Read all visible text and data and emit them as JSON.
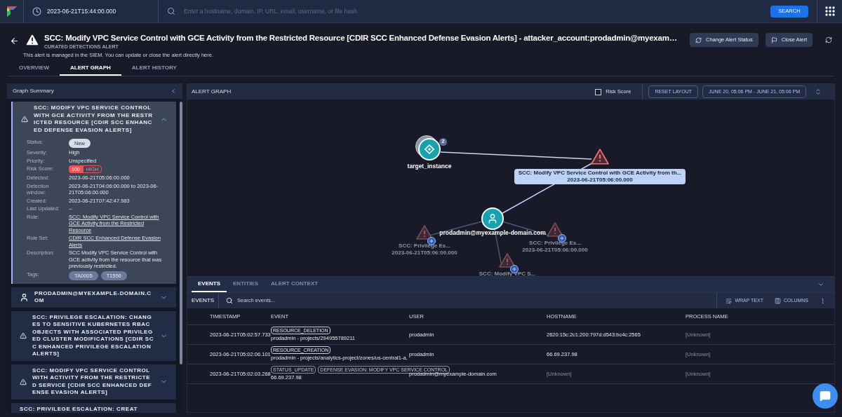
{
  "top_bar": {
    "time": "2023-06-21T15:44:00.000",
    "search_placeholder": "Enter a hostname, domain, IP, URL, email, username, or file hash",
    "search_button": "SEARCH"
  },
  "header": {
    "title": "SCC: Modify VPC Service Control with GCE Activity from the Restricted Resource [CDIR SCC Enhanced Defense Evasion Alerts] - attacker_account:prodadmin@myexam…",
    "subtitle": "CURATED DETECTIONS ALERT",
    "note": "This alert is managed in the SIEM. You can update or close the alert directly here.",
    "buttons": [
      {
        "kind": "status",
        "label": "Change Alert Status"
      },
      {
        "kind": "close",
        "label": "Close Alert"
      }
    ]
  },
  "tabs": [
    {
      "label": "OVERVIEW",
      "selected": false
    },
    {
      "label": "ALERT GRAPH",
      "selected": true
    },
    {
      "label": "ALERT HISTORY",
      "selected": false
    }
  ],
  "summary": {
    "title": "Graph Summary",
    "items": [
      {
        "kind": "alert",
        "title": "SCC: MODIFY VPC SERVICE CONTROL WITH GCE ACTIVITY FROM THE RESTRICTED RESOURCE [CDIR SCC ENHANCED DEFENSE EVASION ALERTS]",
        "expanded": true,
        "fields": [
          {
            "kind": "pill",
            "label": "Status:",
            "value": "New"
          },
          {
            "kind": "text",
            "label": "Severity:",
            "value": "High"
          },
          {
            "kind": "text",
            "label": "Priority:",
            "value": "Unspecified"
          },
          {
            "kind": "risk",
            "label": "Risk Score:",
            "score": "100",
            "level_text": "HIGH"
          },
          {
            "kind": "text",
            "label": "Detected:",
            "value": "2023-06-21T05:06:00.000"
          },
          {
            "kind": "text",
            "label": "Detection window:",
            "value": "2023-06-21T04:06:00.000 to 2023-06-21T05:06:00.000"
          },
          {
            "kind": "text",
            "label": "Created:",
            "value": "2023-06-21T07:42:47.983"
          },
          {
            "kind": "text",
            "label": "Last Updated:",
            "value": "--"
          },
          {
            "kind": "link",
            "label": "Rule:",
            "value": "SCC: Modify VPC Service Control with GCE Activity from the Restricted Resource"
          },
          {
            "kind": "link",
            "label": "Rule Set:",
            "value": "CDIR SCC Enhanced Defense Evasion Alerts"
          },
          {
            "kind": "text",
            "label": "Description:",
            "value": "SCC Modify VPC Service Control with GCE activity from the resource that was previously restricted."
          },
          {
            "kind": "tags",
            "label": "Tags:",
            "tags": [
              "TA0005",
              "T1556"
            ]
          }
        ]
      },
      {
        "kind": "user",
        "title": "PRODADMIN@MYEXAMPLE-DOMAIN.COM",
        "expanded": false
      },
      {
        "kind": "alert",
        "title": "SCC: PRIVILEGE ESCALATION: CHANGES TO SENSITIVE KUBERNETES RBAC OBJECTS WITH ASSOCIATED PRIVILEGED CLUSTER MODIFICATIONS [CDIR SCC ENHANCED PRIVILEGE ESCALATION ALERTS]",
        "expanded": false
      },
      {
        "kind": "alert",
        "title": "SCC: MODIFY VPC SERVICE CONTROL WITH ACTIVITY FROM THE RESTRICTED SERVICE [CDIR SCC ENHANCED DEFENSE EVASION ALERTS]",
        "expanded": false
      },
      {
        "kind": "partial",
        "title": "SCC: PRIVILEGE ESCALATION: CREAT",
        "expanded": false
      }
    ]
  },
  "graph": {
    "title": "ALERT GRAPH",
    "risk_score": {
      "label": "Risk Score",
      "checked": false
    },
    "reset": "RESET LAYOUT",
    "range": "JUNE 20, 05:06 PM - JUNE 21, 05:06 PM",
    "nodes": [
      {
        "kind": "asset",
        "label": "target_instance",
        "badge": "2"
      },
      {
        "kind": "alert",
        "label": "SCC: Modify VPC Service Control with GCE Activity from th...",
        "sublabel": "2023-06-21T05:06:00.000",
        "selected": true
      },
      {
        "kind": "user",
        "label": "prodadmin@myexample-domain.com"
      },
      {
        "kind": "alert",
        "label": "SCC: Privilege Es...",
        "sublabel": "2023-06-21T05:06:00.000",
        "selected": false
      },
      {
        "kind": "alert",
        "label": "SCC: Privilege Es...",
        "sublabel": "2023-06-21T05:06:00.000",
        "selected": false
      },
      {
        "kind": "alert",
        "label": "SCC: Modify VPC S...",
        "selected": false
      }
    ]
  },
  "events": {
    "tabs": [
      {
        "label": "EVENTS",
        "selected": true
      },
      {
        "label": "ENTITIES",
        "selected": false
      },
      {
        "label": "ALERT CONTEXT",
        "selected": false
      }
    ],
    "label": "EVENTS",
    "search_placeholder": "Search events...",
    "wrap": "WRAP TEXT",
    "columns_button": "COLUMNS",
    "columns": [
      "TIMESTAMP",
      "EVENT",
      "USER",
      "HOSTNAME",
      "PROCESS NAME"
    ],
    "rows": [
      {
        "timestamp": "2023-06-21T05:02:57.733",
        "tags": [
          "RESOURCE_DELETION"
        ],
        "event": "prodadmin - projects/294955789211",
        "user": "prodadmin",
        "hostname": {
          "text": "2620:15c:2c1:200:797d:d543:bc4c:2565",
          "dim": false
        },
        "process": {
          "text": "[Unknown]",
          "dim": true
        }
      },
      {
        "timestamp": "2023-06-21T05:02:06.101",
        "tags": [
          "RESOURCE_CREATION"
        ],
        "event": "prodadmin - projects/analytics-project/zones/us-central1-a,",
        "user": "prodadmin",
        "hostname": {
          "text": "66.69.237.98",
          "dim": false
        },
        "process": {
          "text": "[Unknown]",
          "dim": true
        }
      },
      {
        "timestamp": "2023-06-21T05:02:03.268",
        "tags": [
          "STATUS_UPDATE",
          "DEFENSE EVASION: MODIFY VPC SERVICE CONTROL"
        ],
        "event": "66.69.237.98",
        "user": "prodadmin@myexample-domain.com",
        "hostname": {
          "text": "[Unknown]",
          "dim": true
        },
        "process": {
          "text": "[Unknown]",
          "dim": true
        }
      }
    ]
  }
}
